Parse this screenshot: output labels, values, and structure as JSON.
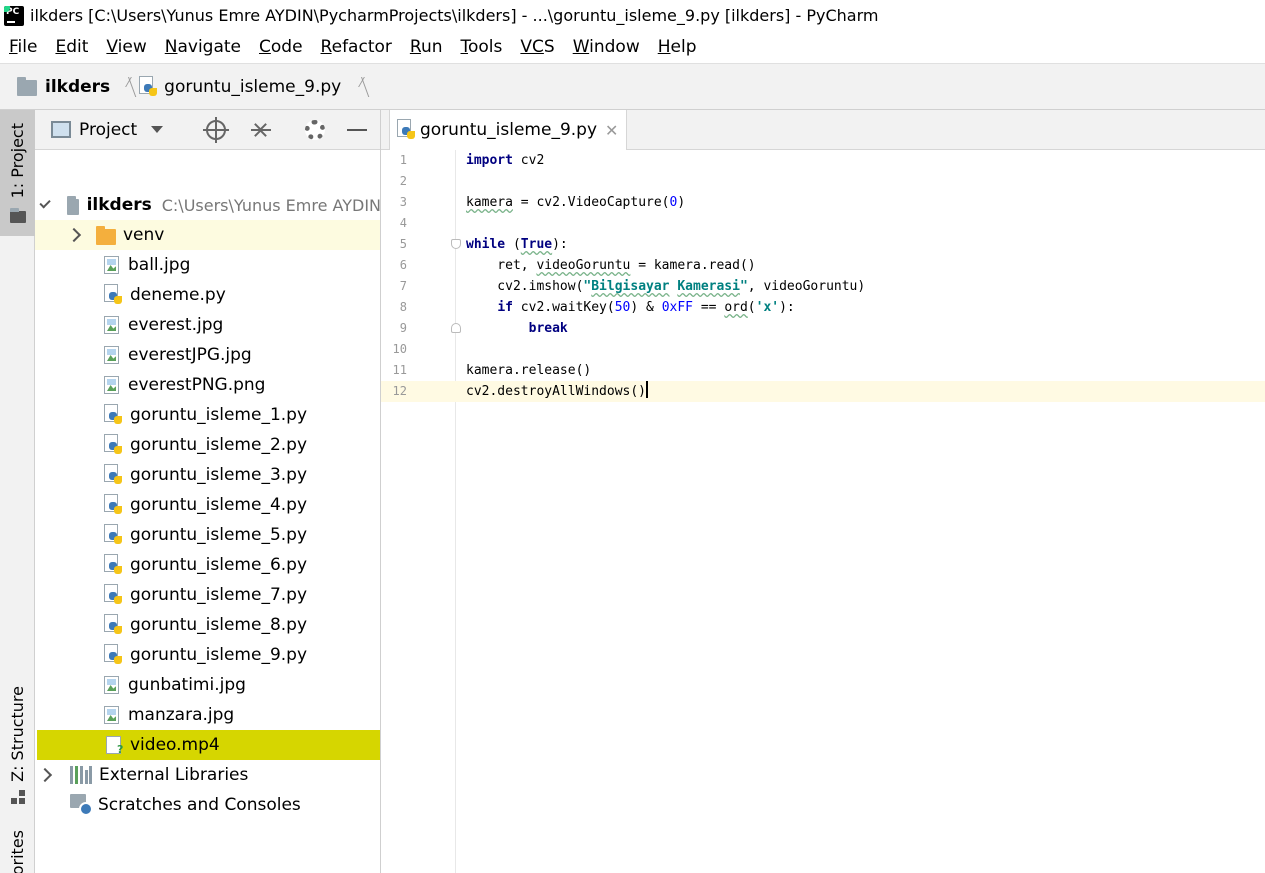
{
  "window": {
    "title": "ilkders [C:\\Users\\Yunus Emre AYDIN\\PycharmProjects\\ilkders] - ...\\goruntu_isleme_9.py [ilkders] - PyCharm"
  },
  "menu": [
    {
      "key": "F",
      "rest": "ile"
    },
    {
      "key": "E",
      "rest": "dit"
    },
    {
      "key": "V",
      "rest": "iew"
    },
    {
      "key": "N",
      "rest": "avigate"
    },
    {
      "key": "C",
      "rest": "ode"
    },
    {
      "key": "R",
      "rest": "efactor"
    },
    {
      "key": "R",
      "rest": "un"
    },
    {
      "key": "T",
      "rest": "ools"
    },
    {
      "key": "VC",
      "rest": "S"
    },
    {
      "key": "W",
      "rest": "indow"
    },
    {
      "key": "H",
      "rest": "elp"
    }
  ],
  "breadcrumb": {
    "project": "ilkders",
    "file": "goruntu_isleme_9.py"
  },
  "toolstrip": {
    "project_tab": "1: Project",
    "structure_tab": "Z: Structure",
    "favorites_tab": "orites"
  },
  "project_panel": {
    "view_label": "Project",
    "root_name": "ilkders",
    "root_path": "C:\\Users\\Yunus Emre AYDIN",
    "items": [
      {
        "name": "venv",
        "type": "folder"
      },
      {
        "name": "ball.jpg",
        "type": "image"
      },
      {
        "name": "deneme.py",
        "type": "python"
      },
      {
        "name": "everest.jpg",
        "type": "image"
      },
      {
        "name": "everestJPG.jpg",
        "type": "image"
      },
      {
        "name": "everestPNG.png",
        "type": "image"
      },
      {
        "name": "goruntu_isleme_1.py",
        "type": "python"
      },
      {
        "name": "goruntu_isleme_2.py",
        "type": "python"
      },
      {
        "name": "goruntu_isleme_3.py",
        "type": "python"
      },
      {
        "name": "goruntu_isleme_4.py",
        "type": "python"
      },
      {
        "name": "goruntu_isleme_5.py",
        "type": "python"
      },
      {
        "name": "goruntu_isleme_6.py",
        "type": "python"
      },
      {
        "name": "goruntu_isleme_7.py",
        "type": "python"
      },
      {
        "name": "goruntu_isleme_8.py",
        "type": "python"
      },
      {
        "name": "goruntu_isleme_9.py",
        "type": "python"
      },
      {
        "name": "gunbatimi.jpg",
        "type": "image"
      },
      {
        "name": "manzara.jpg",
        "type": "image"
      },
      {
        "name": "video.mp4",
        "type": "video"
      }
    ],
    "external_libraries": "External Libraries",
    "scratches": "Scratches and Consoles"
  },
  "editor": {
    "tab_label": "goruntu_isleme_9.py",
    "line_numbers": [
      "1",
      "2",
      "3",
      "4",
      "5",
      "6",
      "7",
      "8",
      "9",
      "10",
      "11",
      "12"
    ],
    "code": {
      "l1_kw": "import",
      "l1_rest": " cv2",
      "l3_var": "kamera",
      "l3_mid": " = cv2.VideoCapture(",
      "l3_num": "0",
      "l3_end": ")",
      "l5_kw": "while",
      "l5_sp": " (",
      "l5_true": "True",
      "l5_end": "):",
      "l6_a": "    ret, ",
      "l6_var": "videoGoruntu",
      "l6_b": " = kamera.read()",
      "l7_a": "    cv2.imshow(",
      "l7_s1": "\"",
      "l7_w1": "Bilgisayar",
      "l7_sp": " ",
      "l7_w2": "Kamerasi",
      "l7_s2": "\"",
      "l7_b": ", videoGoruntu)",
      "l8_ind": "    ",
      "l8_kw": "if",
      "l8_a": " cv2.waitKey(",
      "l8_n1": "50",
      "l8_b": ") & ",
      "l8_n2": "0xFF",
      "l8_c": " == ",
      "l8_ord": "ord",
      "l8_d": "(",
      "l8_s": "'x'",
      "l8_e": "):",
      "l9_ind": "        ",
      "l9_kw": "break",
      "l11": "kamera.release()",
      "l12": "cv2.destroyAllWindows()"
    }
  },
  "colors": {
    "selection_highlight": "#d6d600",
    "venv_highlight": "#fdfbe0",
    "current_line": "#fffae3"
  }
}
